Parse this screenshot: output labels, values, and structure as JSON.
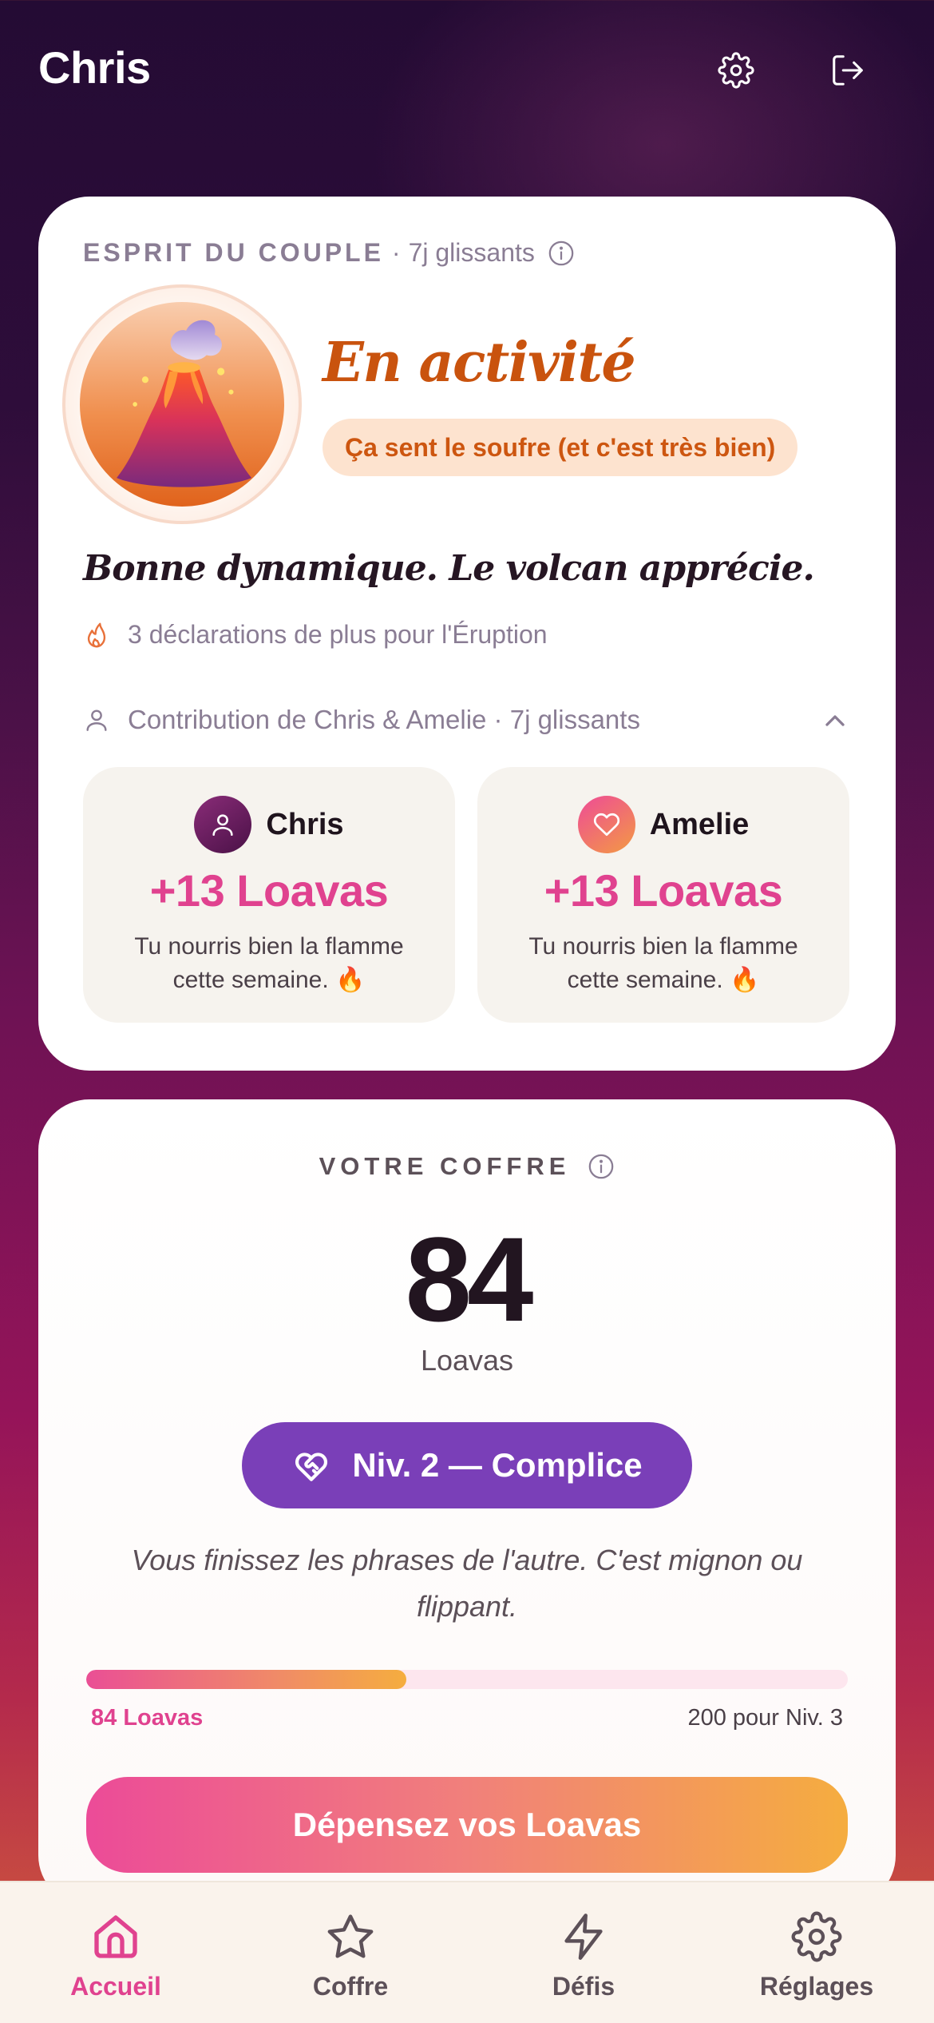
{
  "header": {
    "user_name": "Chris"
  },
  "spirit": {
    "label": "ESPRIT DU COUPLE",
    "window": "7j glissants",
    "status_title": "En activité",
    "status_badge": "Ça sent le soufre (et c'est très bien)",
    "tagline": "Bonne dynamique. Le volcan apprécie.",
    "eruption_hint": "3 déclarations de plus pour l'Éruption",
    "contribution_label": "Contribution de Chris & Amelie · 7j glissants",
    "partners": [
      {
        "name": "Chris",
        "amount": "+13 Loavas",
        "message": "Tu nourris bien la flamme cette semaine. 🔥"
      },
      {
        "name": "Amelie",
        "amount": "+13 Loavas",
        "message": "Tu nourris bien la flamme cette semaine. 🔥"
      }
    ]
  },
  "vault": {
    "label": "VOTRE COFFRE",
    "amount": "84",
    "unit": "Loavas",
    "level": "Niv. 2 — Complice",
    "level_description": "Vous finissez les phrases de l'autre. C'est mignon ou flippant.",
    "progress": {
      "current_label": "84 Loavas",
      "target_label": "200 pour Niv. 3",
      "fraction": 0.42
    },
    "cta": "Dépensez vos Loavas"
  },
  "nav": {
    "items": [
      {
        "label": "Accueil",
        "icon": "home-icon",
        "active": true
      },
      {
        "label": "Coffre",
        "icon": "star-icon",
        "active": false
      },
      {
        "label": "Défis",
        "icon": "lightning-icon",
        "active": false
      },
      {
        "label": "Réglages",
        "icon": "gear-icon",
        "active": false
      }
    ]
  },
  "colors": {
    "accent_pink": "#e0428f",
    "accent_orange": "#c9530e",
    "level_purple": "#7a3fb8",
    "background_top": "#240b34",
    "background_bottom": "#d4613a"
  }
}
